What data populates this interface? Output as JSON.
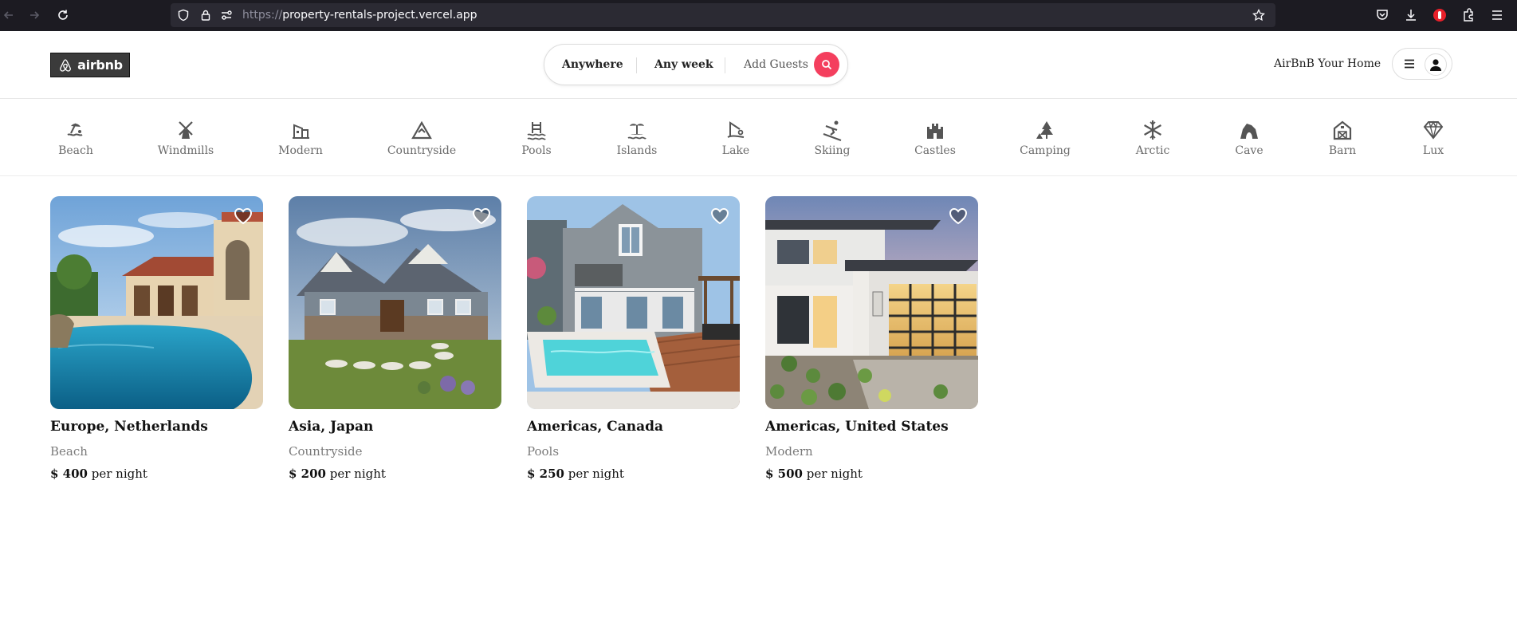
{
  "browser": {
    "url_prefix": "https://",
    "url_host": "property-rentals-project.vercel.app"
  },
  "header": {
    "logo_text": "airbnb",
    "search": {
      "anywhere": "Anywhere",
      "any_week": "Any week",
      "add_guests": "Add Guests"
    },
    "host_link": "AirBnB Your Home"
  },
  "categories": [
    {
      "label": "Beach",
      "icon": "beach-icon"
    },
    {
      "label": "Windmills",
      "icon": "windmill-icon"
    },
    {
      "label": "Modern",
      "icon": "modern-icon"
    },
    {
      "label": "Countryside",
      "icon": "mountain-icon"
    },
    {
      "label": "Pools",
      "icon": "pool-icon"
    },
    {
      "label": "Islands",
      "icon": "island-icon"
    },
    {
      "label": "Lake",
      "icon": "lake-icon"
    },
    {
      "label": "Skiing",
      "icon": "ski-icon"
    },
    {
      "label": "Castles",
      "icon": "castle-icon"
    },
    {
      "label": "Camping",
      "icon": "tree-icon"
    },
    {
      "label": "Arctic",
      "icon": "snowflake-icon"
    },
    {
      "label": "Cave",
      "icon": "cave-icon"
    },
    {
      "label": "Barn",
      "icon": "barn-icon"
    },
    {
      "label": "Lux",
      "icon": "diamond-icon"
    }
  ],
  "listings": [
    {
      "title": "Europe, Netherlands",
      "category": "Beach",
      "price": "$ 400",
      "per": "per night"
    },
    {
      "title": "Asia, Japan",
      "category": "Countryside",
      "price": "$ 200",
      "per": "per night"
    },
    {
      "title": "Americas, Canada",
      "category": "Pools",
      "price": "$ 250",
      "per": "per night"
    },
    {
      "title": "Americas, United States",
      "category": "Modern",
      "price": "$ 500",
      "per": "per night"
    }
  ],
  "colors": {
    "accent": "#f43f5e",
    "browser_bg": "#1c1b22"
  }
}
